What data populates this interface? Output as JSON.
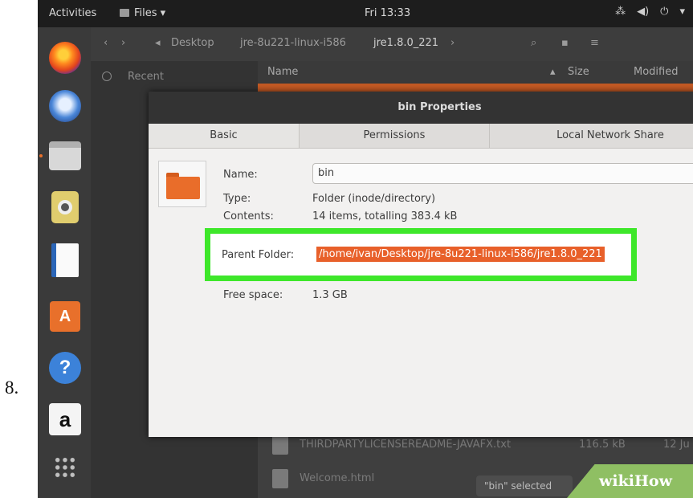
{
  "step_number": "8.",
  "topbar": {
    "activities": "Activities",
    "app_menu": "Files ▾",
    "clock": "Fri 13:33",
    "tray": [
      "⁂",
      "◀)",
      "⏻",
      "▾"
    ]
  },
  "file_manager": {
    "path": [
      "Desktop",
      "jre-8u221-linux-i586",
      "jre1.8.0_221"
    ],
    "sidebar_recent": "Recent",
    "columns": {
      "name": "Name",
      "size": "Size",
      "modified": "Modified"
    },
    "rows": [
      {
        "name": "THIRDPARTYLICENSEREADME-JAVAFX.txt",
        "size": "116.5 kB",
        "modified": "12 Ju"
      },
      {
        "name": "Welcome.html",
        "size": "",
        "modified": ""
      }
    ],
    "status": "\"bin\" selected"
  },
  "dialog": {
    "title": "bin Properties",
    "tabs": [
      "Basic",
      "Permissions",
      "Local Network Share"
    ],
    "name_label": "Name:",
    "name_value": "bin",
    "type_label": "Type:",
    "type_value": "Folder (inode/directory)",
    "contents_label": "Contents:",
    "contents_value": "14 items, totalling 383.4 kB",
    "parent_label": "Parent Folder:",
    "parent_value": "/home/ivan/Desktop/jre-8u221-linux-i586/jre1.8.0_221",
    "free_label": "Free space:",
    "free_value": "1.3 GB"
  },
  "watermark": "wikiHow",
  "colors": {
    "accent": "#e8702b",
    "highlight": "#3ee72a",
    "selection": "#e8602a"
  }
}
